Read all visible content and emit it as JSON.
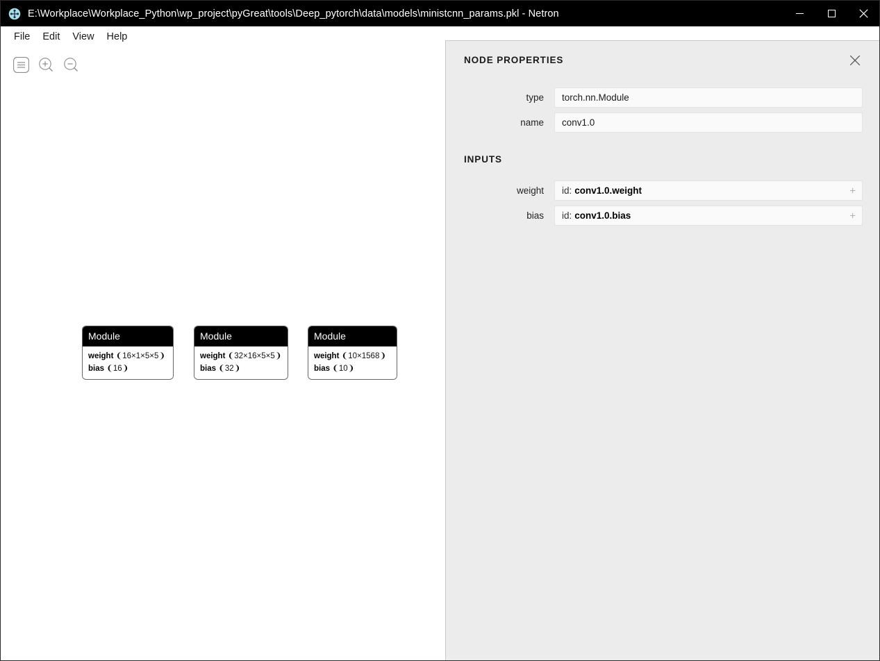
{
  "window": {
    "title": "E:\\Workplace\\Workplace_Python\\wp_project\\pyGreat\\tools\\Deep_pytorch\\data\\models\\ministcnn_params.pkl - Netron",
    "app_icon": "netron-icon",
    "controls": {
      "minimize": "minimize-icon",
      "maximize": "maximize-icon",
      "close": "close-icon"
    }
  },
  "menu": {
    "items": [
      {
        "label": "File"
      },
      {
        "label": "Edit"
      },
      {
        "label": "View"
      },
      {
        "label": "Help"
      }
    ]
  },
  "toolbar": {
    "buttons": [
      {
        "icon": "menu-icon",
        "label": "Menu"
      },
      {
        "icon": "zoom-in-icon",
        "label": "Zoom In"
      },
      {
        "icon": "zoom-out-icon",
        "label": "Zoom Out"
      }
    ]
  },
  "graph": {
    "nodes": [
      {
        "header": "Module",
        "attributes": [
          {
            "name": "weight",
            "shape": "❨16×1×5×5❩"
          },
          {
            "name": "bias",
            "shape": "❨16❩"
          }
        ]
      },
      {
        "header": "Module",
        "attributes": [
          {
            "name": "weight",
            "shape": "❨32×16×5×5❩"
          },
          {
            "name": "bias",
            "shape": "❨32❩"
          }
        ]
      },
      {
        "header": "Module",
        "attributes": [
          {
            "name": "weight",
            "shape": "❨10×1568❩"
          },
          {
            "name": "bias",
            "shape": "❨10❩"
          }
        ]
      }
    ]
  },
  "sidebar": {
    "title": "NODE PROPERTIES",
    "close_icon": "close-icon",
    "fields": [
      {
        "label": "type",
        "value": "torch.nn.Module"
      },
      {
        "label": "name",
        "value": "conv1.0"
      }
    ],
    "inputs_section": {
      "title": "INPUTS",
      "items": [
        {
          "label": "weight",
          "prefix": "id:",
          "id": "conv1.0.weight",
          "expander": "+"
        },
        {
          "label": "bias",
          "prefix": "id:",
          "id": "conv1.0.bias",
          "expander": "+"
        }
      ]
    }
  },
  "colors": {
    "titlebar_bg": "#000000",
    "sidebar_bg": "#ececec",
    "node_header_bg": "#000000",
    "field_bg": "#fafafa",
    "accent_icon": "#7f7f7f"
  }
}
